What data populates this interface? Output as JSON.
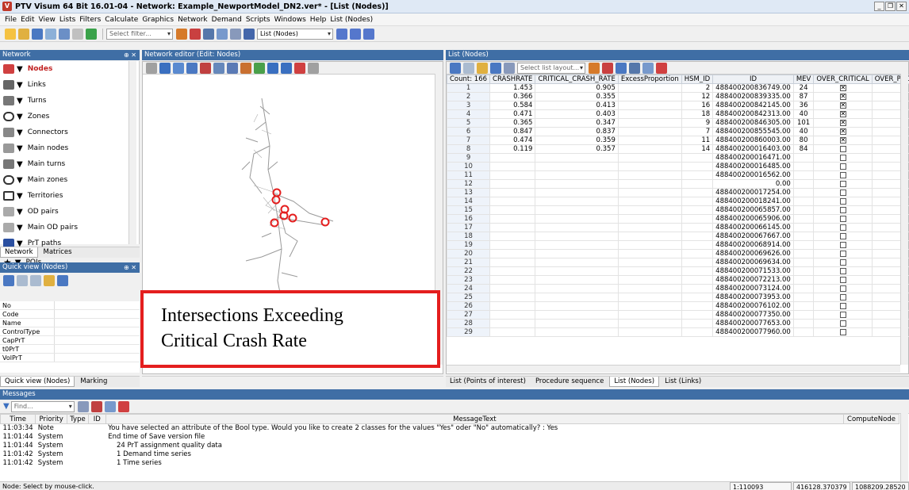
{
  "window": {
    "title": "PTV Visum 64 Bit 16.01-04 - Network: Example_NewportModel_DN2.ver* - [List (Nodes)]",
    "logo": "V"
  },
  "menu": [
    "File",
    "Edit",
    "View",
    "Lists",
    "Filters",
    "Calculate",
    "Graphics",
    "Network",
    "Demand",
    "Scripts",
    "Windows",
    "Help",
    "List (Nodes)"
  ],
  "toolbar": {
    "filter_placeholder": "Select filter...",
    "list_combo": "List (Nodes)"
  },
  "network_panel": {
    "title": "Network",
    "items": [
      "Nodes",
      "Links",
      "Turns",
      "Zones",
      "Connectors",
      "Main nodes",
      "Main turns",
      "Main zones",
      "Territories",
      "OD pairs",
      "Main OD pairs",
      "PrT paths",
      "POIs"
    ],
    "tabs": [
      "Network",
      "Matrices"
    ]
  },
  "quickview": {
    "title": "Quick view (Nodes)",
    "rows": [
      "No",
      "Code",
      "Name",
      "ControlType",
      "CapPrT",
      "t0PrT",
      "VolPrT"
    ],
    "tabs": [
      "Quick view (Nodes)",
      "Marking"
    ]
  },
  "editor": {
    "title": "Network editor (Edit: Nodes)"
  },
  "list": {
    "title": "List (Nodes)",
    "layout_placeholder": "Select list layout...",
    "columns": [
      "Count: 166",
      "CRASHRATE",
      "CRITICAL_CRASH_RATE",
      "ExcessProportion",
      "HSM_ID",
      "ID",
      "MEV",
      "OVER_CRITICAL",
      "OVER_PROBLIMIT"
    ],
    "rows": [
      [
        "1",
        "1.453",
        "0.905",
        "",
        "2",
        "488400200836749.00",
        "24",
        "1",
        "0"
      ],
      [
        "2",
        "0.366",
        "0.355",
        "",
        "12",
        "488400200839335.00",
        "87",
        "1",
        "0"
      ],
      [
        "3",
        "0.584",
        "0.413",
        "",
        "16",
        "488400200842145.00",
        "36",
        "1",
        "0"
      ],
      [
        "4",
        "0.471",
        "0.403",
        "",
        "18",
        "488400200842313.00",
        "40",
        "1",
        "0"
      ],
      [
        "5",
        "0.365",
        "0.347",
        "",
        "9",
        "488400200846305.00",
        "101",
        "1",
        "0"
      ],
      [
        "6",
        "0.847",
        "0.837",
        "",
        "7",
        "488400200855545.00",
        "40",
        "1",
        "0"
      ],
      [
        "7",
        "0.474",
        "0.359",
        "",
        "11",
        "488400200860003.00",
        "80",
        "1",
        "0"
      ],
      [
        "8",
        "0.119",
        "0.357",
        "",
        "14",
        "488400200016403.00",
        "84",
        "0",
        "0"
      ],
      [
        "9",
        "",
        "",
        "",
        "",
        "488400200016471.00",
        "",
        "0",
        "0"
      ],
      [
        "10",
        "",
        "",
        "",
        "",
        "488400200016485.00",
        "",
        "0",
        "0"
      ],
      [
        "11",
        "",
        "",
        "",
        "",
        "488400200016562.00",
        "",
        "0",
        "0"
      ],
      [
        "12",
        "",
        "",
        "",
        "",
        "0.00",
        "",
        "0",
        "0"
      ],
      [
        "13",
        "",
        "",
        "",
        "",
        "488400200017254.00",
        "",
        "0",
        "0"
      ],
      [
        "14",
        "",
        "",
        "",
        "",
        "488400200018241.00",
        "",
        "0",
        "0"
      ],
      [
        "15",
        "",
        "",
        "",
        "",
        "488400200065857.00",
        "",
        "0",
        "0"
      ],
      [
        "16",
        "",
        "",
        "",
        "",
        "488400200065906.00",
        "",
        "0",
        "0"
      ],
      [
        "17",
        "",
        "",
        "",
        "",
        "488400200066145.00",
        "",
        "0",
        "0"
      ],
      [
        "18",
        "",
        "",
        "",
        "",
        "488400200067667.00",
        "",
        "0",
        "0"
      ],
      [
        "19",
        "",
        "",
        "",
        "",
        "488400200068914.00",
        "",
        "0",
        "0"
      ],
      [
        "20",
        "",
        "",
        "",
        "",
        "488400200069626.00",
        "",
        "0",
        "0"
      ],
      [
        "21",
        "",
        "",
        "",
        "",
        "488400200069634.00",
        "",
        "0",
        "0"
      ],
      [
        "22",
        "",
        "",
        "",
        "",
        "488400200071533.00",
        "",
        "0",
        "0"
      ],
      [
        "23",
        "",
        "",
        "",
        "",
        "488400200072213.00",
        "",
        "0",
        "0"
      ],
      [
        "24",
        "",
        "",
        "",
        "",
        "488400200073124.00",
        "",
        "0",
        "0"
      ],
      [
        "25",
        "",
        "",
        "",
        "",
        "488400200073953.00",
        "",
        "0",
        "0"
      ],
      [
        "26",
        "",
        "",
        "",
        "",
        "488400200076102.00",
        "",
        "0",
        "0"
      ],
      [
        "27",
        "",
        "",
        "",
        "",
        "488400200077350.00",
        "",
        "0",
        "0"
      ],
      [
        "28",
        "",
        "",
        "",
        "",
        "488400200077653.00",
        "",
        "0",
        "0"
      ],
      [
        "29",
        "",
        "",
        "",
        "",
        "488400200077960.00",
        "",
        "0",
        "0"
      ]
    ],
    "bottom_tabs": [
      "List (Points of interest)",
      "Procedure sequence",
      "List (Nodes)",
      "List (Links)"
    ]
  },
  "callout": {
    "line1": "Intersections Exceeding",
    "line2": "Critical Crash Rate"
  },
  "messages": {
    "title": "Messages",
    "find_placeholder": "Find...",
    "columns": [
      "Time",
      "Priority",
      "Type",
      "ID",
      "MessageText",
      "ComputeNode"
    ],
    "rows": [
      [
        "11:03:34",
        "Note",
        "",
        "",
        "You have selected an attribute of the Bool type. Would you like to create 2 classes for the values \"Yes\" oder \"No\" automatically? : Yes"
      ],
      [
        "11:01:44",
        "System",
        "",
        "",
        "End time of Save version file"
      ],
      [
        "11:01:44",
        "System",
        "",
        "",
        "    24 PrT assignment quality data"
      ],
      [
        "11:01:42",
        "System",
        "",
        "",
        "    1 Demand time series"
      ],
      [
        "11:01:42",
        "System",
        "",
        "",
        "    1 Time series"
      ]
    ]
  },
  "status": {
    "left": "Node: Select by mouse-click.",
    "scale": "1:110093",
    "coords": "416128.370379",
    "coords2": "1088209.28520"
  },
  "colors": {
    "accent": "#3f6ea5",
    "highlight": "#e41e1e"
  }
}
